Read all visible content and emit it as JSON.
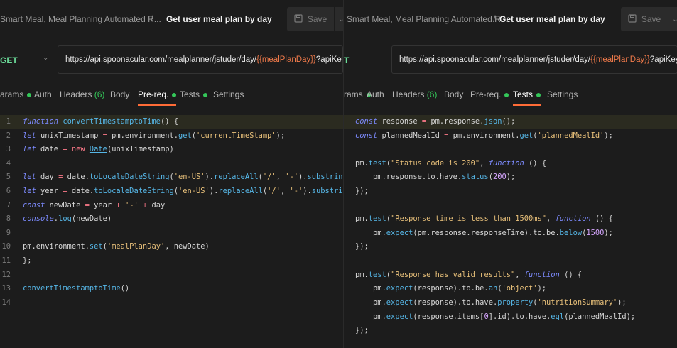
{
  "left": {
    "breadcrumb": {
      "parent": "Smart Meal, Meal Planning Automated R...",
      "separator": "/",
      "title": "Get user meal plan by day"
    },
    "save": {
      "label": "Save"
    },
    "request": {
      "method": "GET",
      "url_prefix": "https://api.spoonacular.com/mealplanner/jstuder/day/",
      "url_variable": "{{mealPlanDay}}",
      "url_suffix": "?apiKey={..."
    },
    "tabs": {
      "params": "arams",
      "auth": "Auth",
      "headers": "Headers",
      "headers_count": "(6)",
      "body": "Body",
      "prereq": "Pre-req.",
      "tests": "Tests",
      "settings": "Settings"
    },
    "line_numbers": [
      "1",
      "2",
      "3",
      "4",
      "5",
      "6",
      "7",
      "8",
      "9",
      "10",
      "11",
      "12",
      "13",
      "14"
    ]
  },
  "right": {
    "breadcrumb": {
      "parent": "Smart Meal, Meal Planning Automated R...",
      "separator": "/",
      "title": "Get user meal plan by day"
    },
    "save": {
      "label": "Save"
    },
    "request": {
      "method": "T",
      "url_prefix": "https://api.spoonacular.com/mealplanner/jstuder/day/",
      "url_variable": "{{mealPlanDay}}",
      "url_suffix": "?apiKey={..."
    },
    "tabs": {
      "params": "rams",
      "auth": "Auth",
      "headers": "Headers",
      "headers_count": "(6)",
      "body": "Body",
      "prereq": "Pre-req.",
      "tests": "Tests",
      "settings": "Settings"
    }
  },
  "colors": {
    "accent": "#ff6c37",
    "method": "#6bdd9a",
    "status_dot": "#34c759",
    "variable": "#f07a4a"
  }
}
